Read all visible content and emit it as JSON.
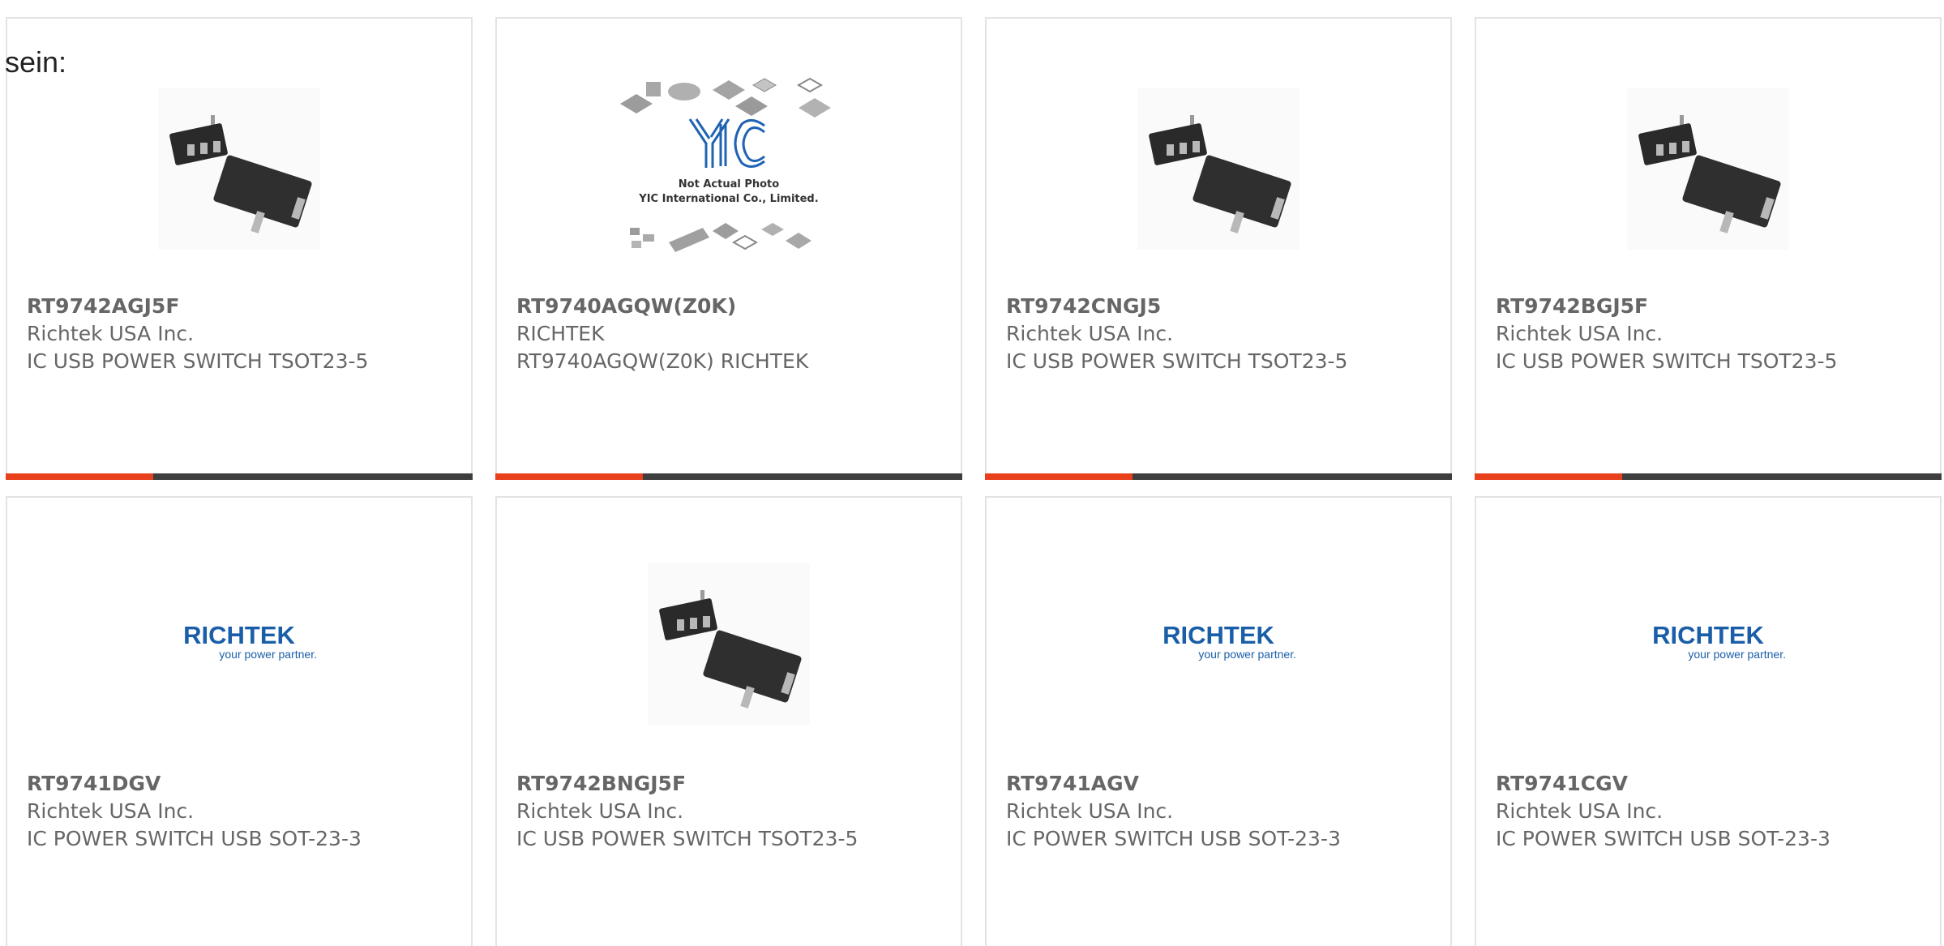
{
  "lead_text": "sein:",
  "products": [
    {
      "part": "RT9742AGJ5F",
      "manufacturer": "Richtek USA Inc.",
      "description": "IC USB POWER SWITCH TSOT23-5",
      "image": "sot23-5-package-icon"
    },
    {
      "part": "RT9740AGQW(Z0K)",
      "manufacturer": "RICHTEK",
      "description": "RT9740AGQW(Z0K) RICHTEK",
      "image": "not-actual-photo-placeholder",
      "placeholder": {
        "logo": "YIC",
        "line1": "Not Actual Photo",
        "line2": "YIC International Co., Limited."
      }
    },
    {
      "part": "RT9742CNGJ5",
      "manufacturer": "Richtek USA Inc.",
      "description": "IC USB POWER SWITCH TSOT23-5",
      "image": "sot23-5-package-icon"
    },
    {
      "part": "RT9742BGJ5F",
      "manufacturer": "Richtek USA Inc.",
      "description": "IC USB POWER SWITCH TSOT23-5",
      "image": "sot23-5-package-icon"
    },
    {
      "part": "RT9741DGV",
      "manufacturer": "Richtek USA Inc.",
      "description": "IC POWER SWITCH USB SOT-23-3",
      "image": "richtek-logo",
      "logo": {
        "name": "RICHTEK",
        "tagline": "your power partner."
      }
    },
    {
      "part": "RT9742BNGJ5F",
      "manufacturer": "Richtek USA Inc.",
      "description": "IC USB POWER SWITCH TSOT23-5",
      "image": "sot23-5-package-icon"
    },
    {
      "part": "RT9741AGV",
      "manufacturer": "Richtek USA Inc.",
      "description": "IC POWER SWITCH USB SOT-23-3",
      "image": "richtek-logo",
      "logo": {
        "name": "RICHTEK",
        "tagline": "your power partner."
      }
    },
    {
      "part": "RT9741CGV",
      "manufacturer": "Richtek USA Inc.",
      "description": "IC POWER SWITCH USB SOT-23-3",
      "image": "richtek-logo",
      "logo": {
        "name": "RICHTEK",
        "tagline": "your power partner."
      }
    }
  ],
  "colors": {
    "accent": "#e8401c",
    "bar": "#3e3e3e",
    "text": "#666666",
    "border": "#e3e3e3",
    "logo_blue": "#1a5ea8"
  }
}
